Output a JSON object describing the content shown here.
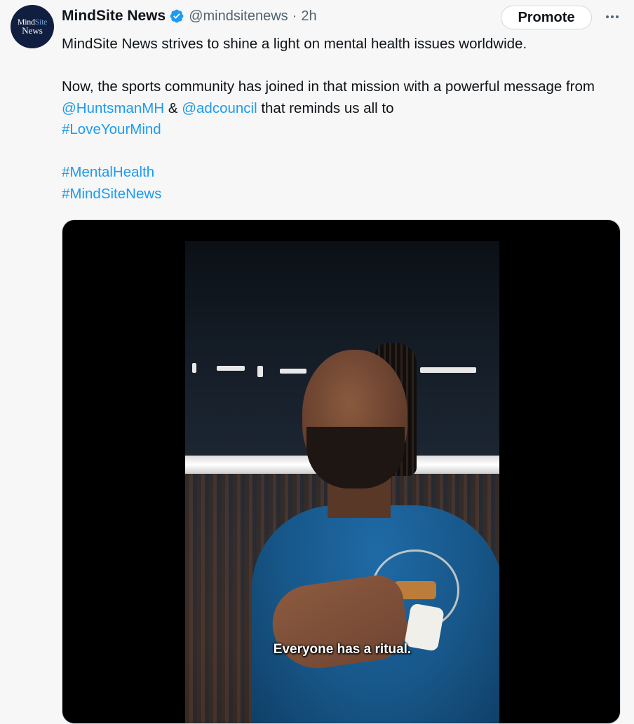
{
  "account": {
    "avatar_line1_a": "Mind",
    "avatar_line1_b": "Site",
    "avatar_line2": "News",
    "name": "MindSite News",
    "handle": "@mindsitenews",
    "separator": "·",
    "time": "2h",
    "verified_icon": "verified-badge-icon"
  },
  "actions": {
    "promote_label": "Promote",
    "more_icon": "more-options-icon"
  },
  "post": {
    "line1": "MindSite News strives to shine a light on mental health issues worldwide.",
    "line2_a": "Now, the sports community has joined in that mission with a powerful message from ",
    "mention1": "@HuntsmanMH",
    "amp": " & ",
    "mention2": "@adcouncil",
    "line2_b": " that reminds us all to",
    "hashtag1": "#LoveYourMind",
    "hashtag2": "#MentalHealth",
    "hashtag3": "#MindSiteNews"
  },
  "video": {
    "caption": "Everyone has a ritual."
  },
  "colors": {
    "link": "#1d9bf0",
    "verified": "#1d9bf0",
    "avatar_bg": "#101f3f"
  }
}
